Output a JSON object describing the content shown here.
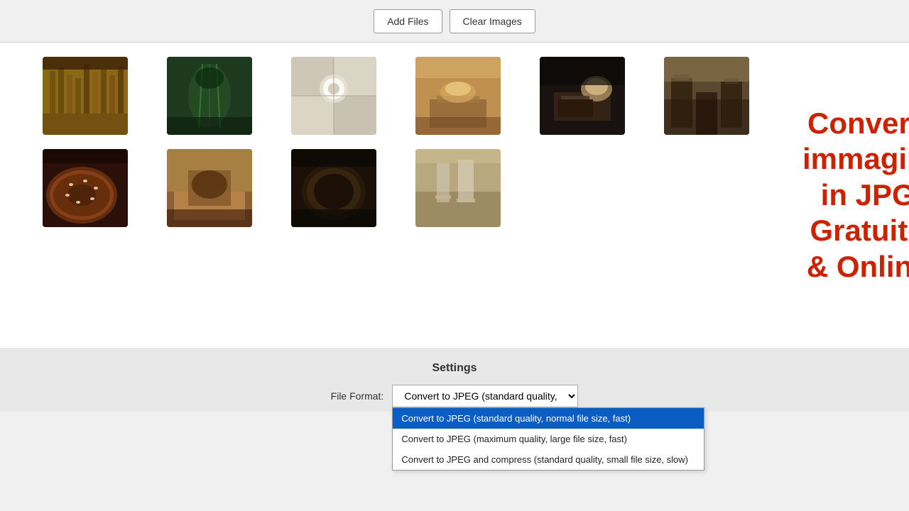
{
  "toolbar": {
    "add_files_label": "Add Files",
    "clear_images_label": "Clear Images"
  },
  "images": {
    "row1": [
      {
        "id": 1,
        "color_class": "img-1",
        "desc": "bar shelves"
      },
      {
        "id": 2,
        "color_class": "img-2",
        "desc": "glass on table"
      },
      {
        "id": 3,
        "color_class": "img-3",
        "desc": "cup on tiles"
      },
      {
        "id": 4,
        "color_class": "img-4",
        "desc": "drink on tray"
      },
      {
        "id": 5,
        "color_class": "img-5",
        "desc": "bread and cup"
      },
      {
        "id": 6,
        "color_class": "img-6",
        "desc": "cafe chairs"
      }
    ],
    "row2": [
      {
        "id": 7,
        "color_class": "img-7",
        "desc": "donut"
      },
      {
        "id": 8,
        "color_class": "img-8",
        "desc": "food plate"
      },
      {
        "id": 9,
        "color_class": "img-9",
        "desc": "bowl overhead"
      },
      {
        "id": 10,
        "color_class": "img-10",
        "desc": "glass drinks"
      }
    ]
  },
  "promo": {
    "line1": "Converti immagini in JPG",
    "line2": "Gratuito & Online"
  },
  "settings": {
    "title": "Settings",
    "file_format_label": "File Format:",
    "selected_option": "Convert to JPEG (standard quality,",
    "options": [
      "Convert to JPEG (standard quality, normal file size, fast)",
      "Convert to JPEG (maximum quality, large file size, fast)",
      "Convert to JPEG and compress (standard quality, small file size, slow)"
    ]
  }
}
